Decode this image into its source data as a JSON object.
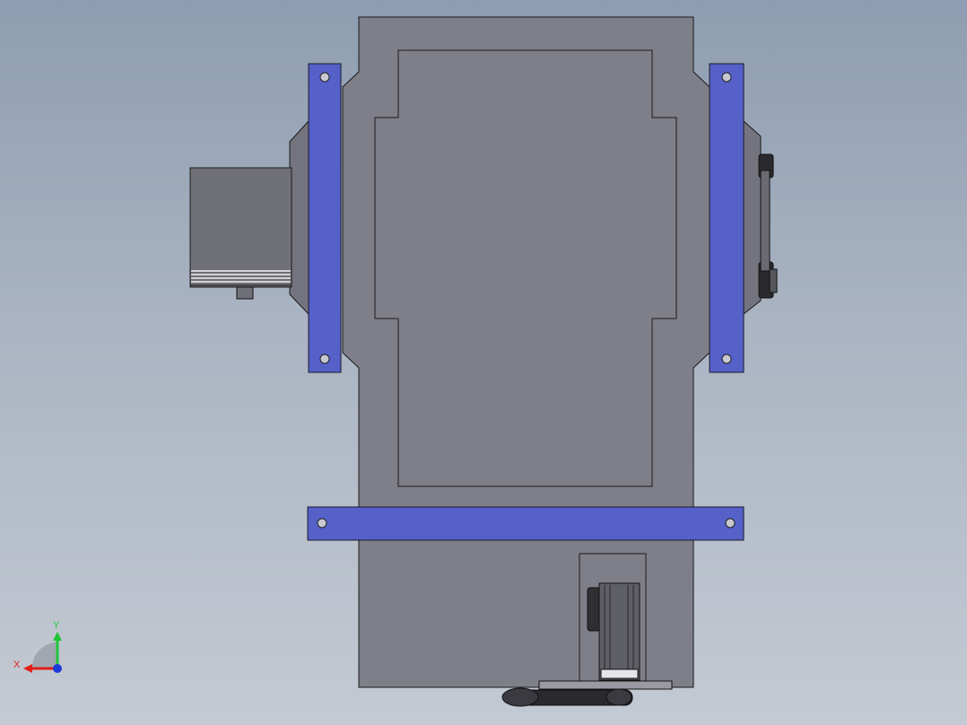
{
  "viewport": {
    "background_top": "#8e9db1",
    "background_bottom": "#c4cad3"
  },
  "model": {
    "body_color": "#7f7f89",
    "body_edge_color": "#1a1a1a",
    "bracket_color": "#5560c9",
    "bracket_edge_color": "#1a1a2a",
    "motor_color": "#707078"
  },
  "triad": {
    "x_label": "X",
    "y_label": "Y",
    "x_color": "#e0201a",
    "y_color": "#22c43a",
    "z_color": "#1e3cd8"
  }
}
